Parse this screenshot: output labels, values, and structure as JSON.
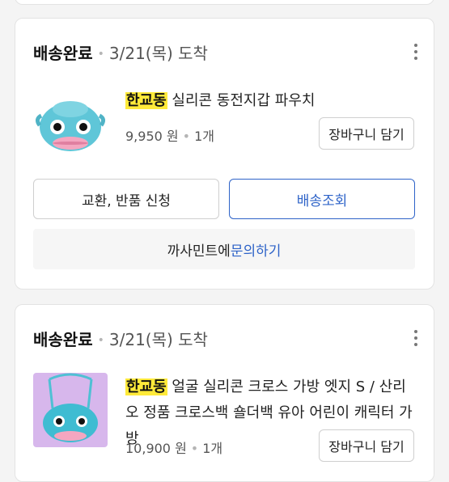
{
  "orders": [
    {
      "status": "배송완료",
      "date": "3/21(목) 도착",
      "product": {
        "highlight": "한교동",
        "title_rest": " 실리콘 동전지갑 파우치",
        "price": "9,950 원",
        "quantity": "1개",
        "image_icon": "hangyodon-coin-purse-image"
      },
      "cart_button": "장바구니 담기",
      "exchange_button": "교환, 반품 신청",
      "tracking_button": "배송조회",
      "inquiry_prefix": "까사민트에 ",
      "inquiry_link": "문의하기"
    },
    {
      "status": "배송완료",
      "date": "3/21(목) 도착",
      "product": {
        "highlight": "한교동",
        "title_rest": " 얼굴 실리콘 크로스 가방 엣지 S / 산리오 정품 크로스백 숄더백 유아 어린이 캐릭터 가방",
        "price": "10,900 원",
        "quantity": "1개",
        "image_icon": "hangyodon-cross-bag-image"
      },
      "cart_button": "장바구니 담기"
    }
  ],
  "colors": {
    "accent": "#2e63c8",
    "highlight": "#ffea3a"
  }
}
